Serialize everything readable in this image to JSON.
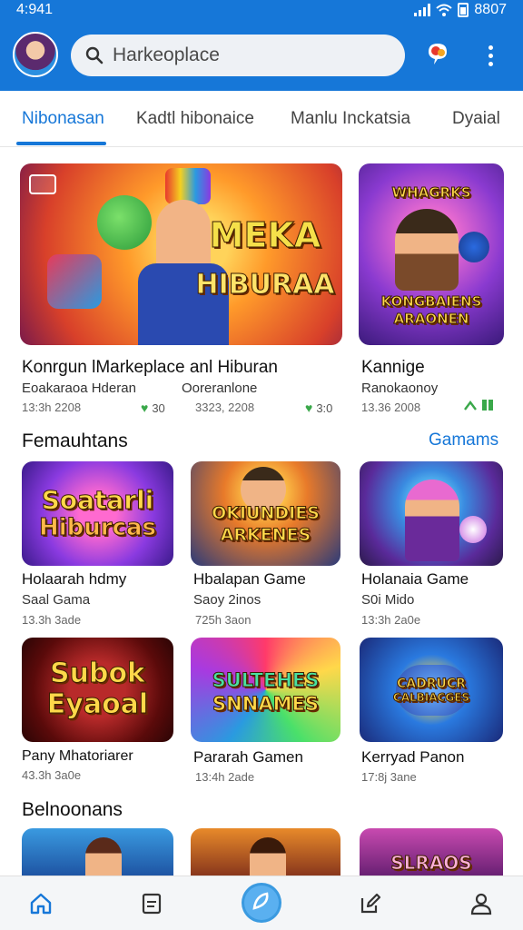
{
  "status": {
    "time": "4:941",
    "battery_text": "8807"
  },
  "search": {
    "placeholder": "Harkeoplace"
  },
  "tabs": [
    {
      "label": "Nibonasan",
      "active": true
    },
    {
      "label": "Kadtl hibonaice",
      "active": false
    },
    {
      "label": "Manlu Inckatsia",
      "active": false
    },
    {
      "label": "Dyaial",
      "active": false
    }
  ],
  "featured": [
    {
      "art_text": [
        "MEKA",
        "HIBURAA"
      ],
      "title": "Konrgun lMarkeplace anl Hiburan",
      "subtitle": "Eoakaraoa Hderan",
      "date": "13:3h 2208",
      "rating": "30"
    },
    {
      "art_text": [
        "WHAGRKS",
        "KONGBAIENS",
        "ARAONEN"
      ],
      "title": "Kannige",
      "subtitle": "Ranokaonoy",
      "date": "13.36 2008"
    }
  ],
  "featured_middle": {
    "subtitle": "Ooreranlone",
    "date": "3323, 2208",
    "rating": "3:0"
  },
  "section1": {
    "title": "Femauhtans",
    "link": "Gamams"
  },
  "grid": [
    {
      "art_text": [
        "Soatarli",
        "Hiburcas"
      ],
      "title": "Holaarah hdmy",
      "subtitle": "Saal Gama",
      "meta": "13.3h 3ade"
    },
    {
      "art_text": [
        "OKIUNDIES",
        "ARKENES"
      ],
      "title": "Hbalapan Game",
      "subtitle": "Saoy 2inos",
      "meta": "725h 3aon"
    },
    {
      "art_text": [],
      "title": "Holanaia Game",
      "subtitle": "S0i Mido",
      "meta": "13:3h 2a0e"
    },
    {
      "art_text": [
        "Subok",
        "Eyaoal"
      ],
      "title": "Pany Mhatoriarer",
      "subtitle": "",
      "meta": "43.3h 3a0e"
    },
    {
      "art_text": [
        "SULTEHES",
        "SNNAMES"
      ],
      "title": "Pararah Gamen",
      "subtitle": "",
      "meta": "13:4h 2ade"
    },
    {
      "art_text": [
        "CADRUCR",
        "CALBIACGES"
      ],
      "title": "Kerryad Panon",
      "subtitle": "",
      "meta": "17:8j 3ane"
    }
  ],
  "section2": {
    "title": "Belnoonans"
  },
  "bottom_art": [
    "",
    "",
    "SLRAOS"
  ],
  "colors": {
    "primary": "#1677d8",
    "rating_green": "#3aa84a"
  }
}
